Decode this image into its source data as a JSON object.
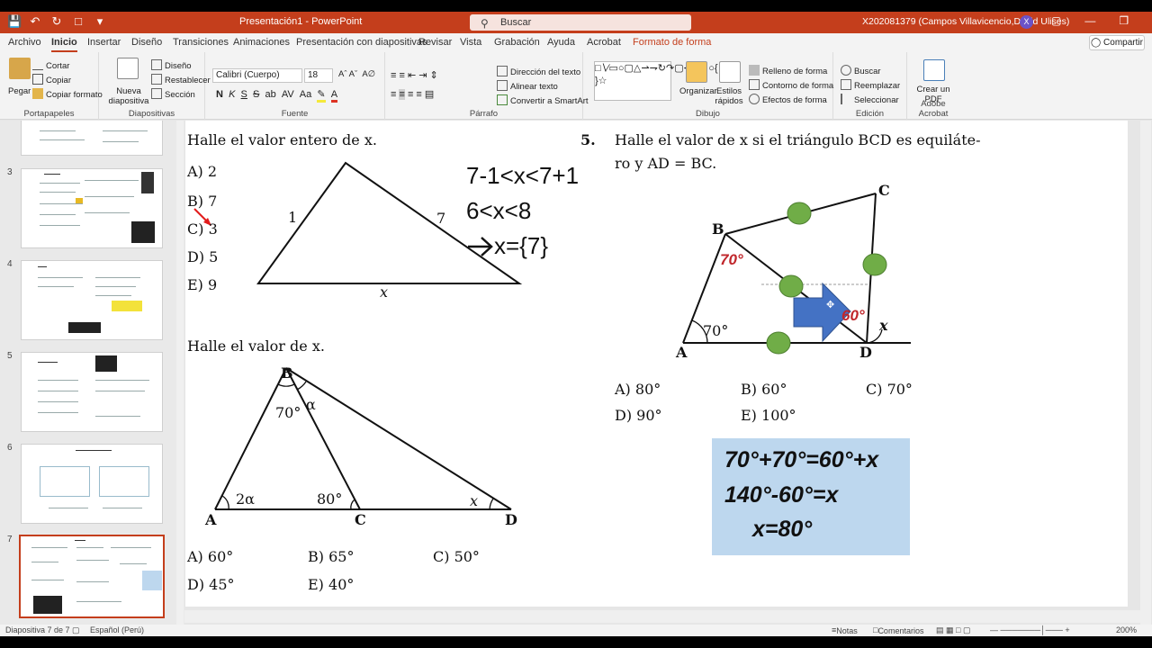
{
  "app": {
    "doc_title": "Presentación1  -  PowerPoint",
    "search_placeholder": "Buscar",
    "user_name": "X202081379 (Campos Villavicencio,David Ulises)",
    "avatar_initial": "X",
    "accent_color": "#c43e1c"
  },
  "tabs": [
    "Archivo",
    "Inicio",
    "Insertar",
    "Diseño",
    "Transiciones",
    "Animaciones",
    "Presentación con diapositivas",
    "Revisar",
    "Vista",
    "Grabación",
    "Ayuda",
    "Acrobat",
    "Formato de forma"
  ],
  "share_label": "Compartir",
  "ribbon": {
    "clipboard": {
      "paste": "Pegar",
      "cut": "Cortar",
      "copy": "Copiar",
      "format_painter": "Copiar formato",
      "label": "Portapapeles"
    },
    "slides": {
      "new_slide": "Nueva diapositiva",
      "layout": "Diseño",
      "reset": "Restablecer",
      "section": "Sección",
      "label": "Diapositivas"
    },
    "font": {
      "name": "Calibri (Cuerpo)",
      "size": "18",
      "label": "Fuente"
    },
    "paragraph": {
      "text_direction": "Dirección del texto",
      "align_text": "Alinear texto",
      "smartart": "Convertir a SmartArt",
      "label": "Párrafo"
    },
    "drawing": {
      "arrange": "Organizar",
      "quick_styles": "Estilos rápidos",
      "shape_fill": "Relleno de forma",
      "shape_outline": "Contorno de forma",
      "shape_effects": "Efectos de forma",
      "label": "Dibujo"
    },
    "editing": {
      "find": "Buscar",
      "replace": "Reemplazar",
      "select": "Seleccionar",
      "label": "Edición"
    },
    "acrobat": {
      "create_pdf": "Crear un PDF",
      "label": "Adobe Acrobat"
    }
  },
  "thumbnails": [
    {
      "number": "3"
    },
    {
      "number": "4"
    },
    {
      "number": "5"
    },
    {
      "number": "6"
    },
    {
      "number": "7"
    }
  ],
  "slide": {
    "q1": {
      "title": "Halle el valor entero de x.",
      "options": [
        "A) 2",
        "B) 7",
        "C) 3",
        "D) 5",
        "E) 9"
      ],
      "side_left": "1",
      "side_right": "7",
      "side_bottom": "x",
      "work": [
        "7-1<x<7+1",
        "6<x<8",
        "x={7}"
      ]
    },
    "q2": {
      "title": "Halle el valor de x.",
      "labels": {
        "B": "B",
        "A": "A",
        "C": "C",
        "D": "D",
        "angle_b": "70°",
        "alpha": "α",
        "angle_a": "2α",
        "angle_c": "80°",
        "angle_d": "x"
      },
      "options": [
        "A) 60°",
        "B) 65°",
        "C) 50°",
        "D) 45°",
        "E) 40°"
      ]
    },
    "q5": {
      "number": "5.",
      "title_line1": "Halle el valor de x si el triángulo BCD es equiláte-",
      "title_line2": "ro y AD = BC.",
      "labels": {
        "A": "A",
        "B": "B",
        "C": "C",
        "D": "D",
        "angle_a": "70°",
        "angle_x": "x",
        "red_b": "70°",
        "red_d": "60°"
      },
      "options": [
        "A) 80°",
        "B) 60°",
        "C) 70°",
        "D) 90°",
        "E) 100°"
      ]
    },
    "solution": [
      "70°+70°=60°+x",
      "140°-60°=x",
      "x=80°"
    ]
  },
  "status": {
    "slide_info": "Diapositiva 7 de 7",
    "language": "Español (Perú)",
    "notes": "Notas",
    "comments": "Comentarios",
    "zoom": "200%"
  }
}
